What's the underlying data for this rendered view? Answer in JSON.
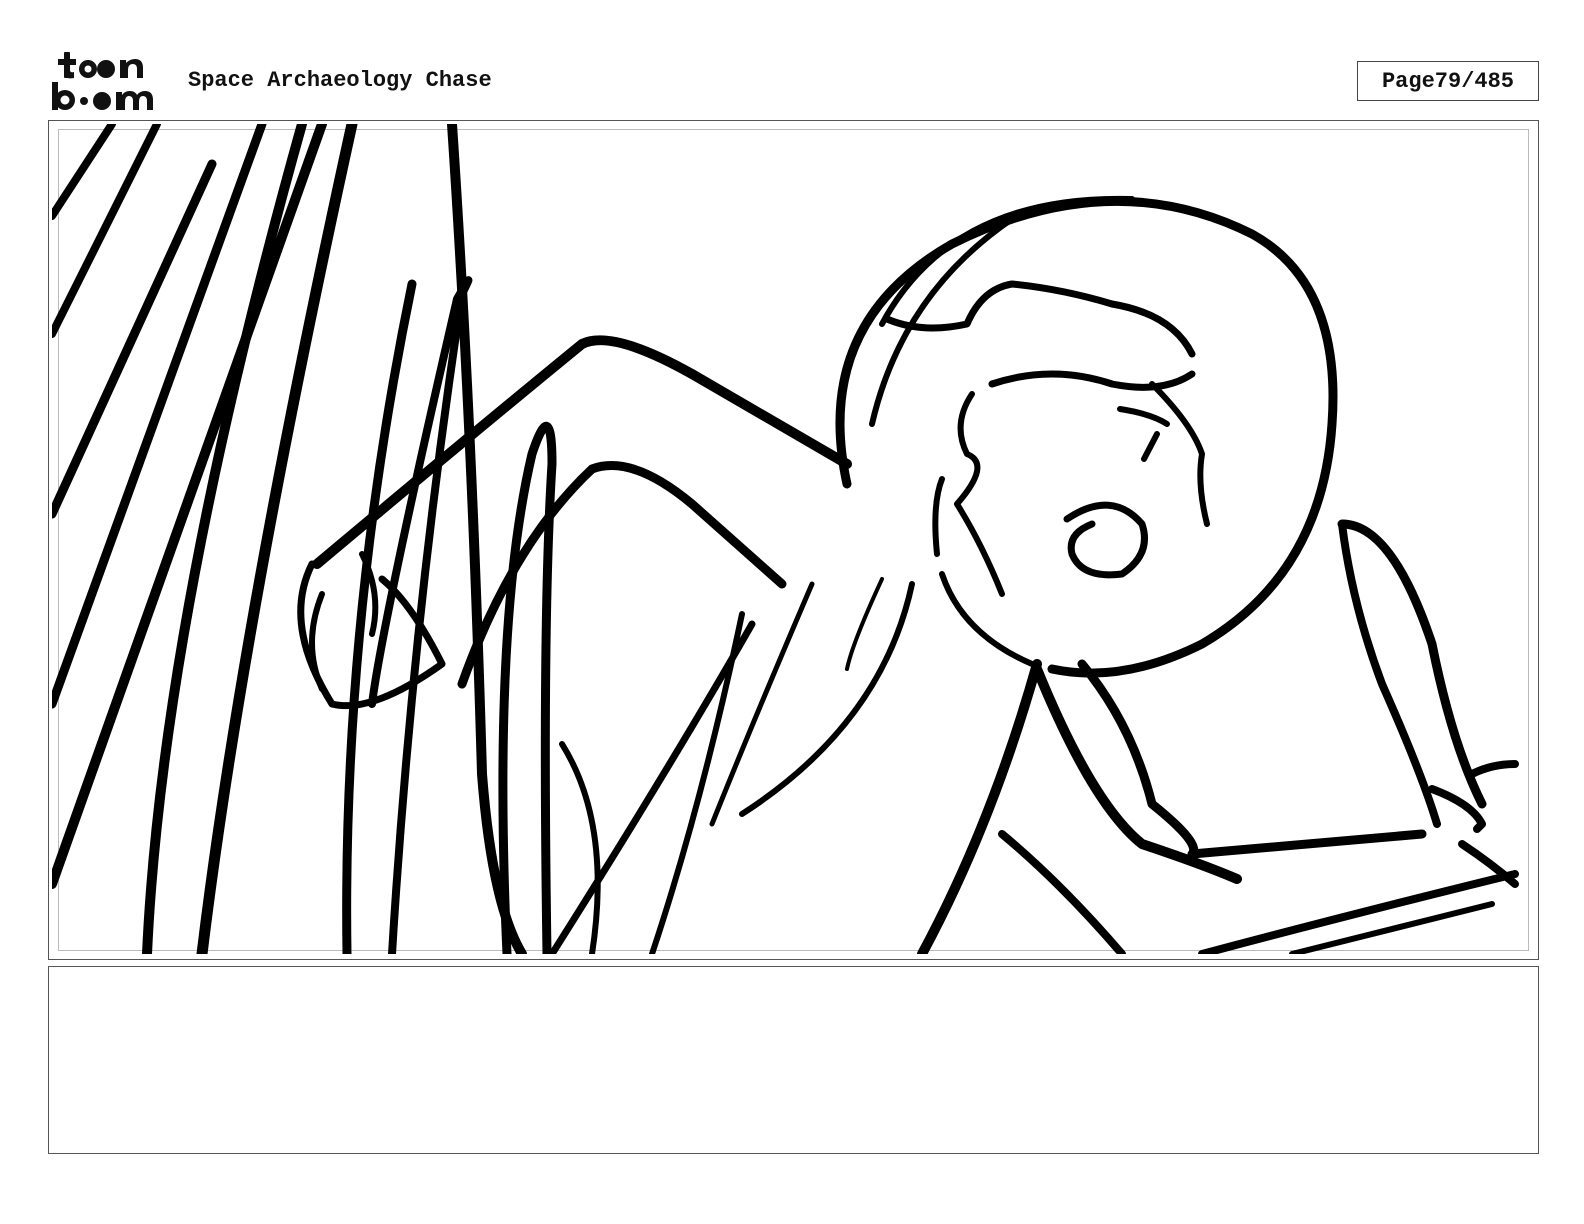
{
  "header": {
    "logo_text": "toonboom",
    "project_title": "Space Archaeology Chase",
    "page_label": "Page",
    "page_number": "79/485"
  },
  "panel": {
    "art": "rough storyboard sketch"
  },
  "caption": {
    "text": ""
  }
}
